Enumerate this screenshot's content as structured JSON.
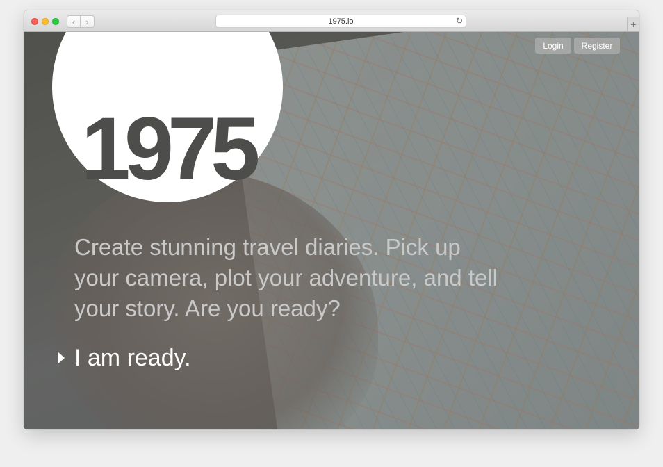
{
  "browser": {
    "url": "1975.io",
    "back_icon": "‹",
    "forward_icon": "›",
    "reload_icon": "↻",
    "new_tab_icon": "+"
  },
  "header": {
    "logo": "1975",
    "login_label": "Login",
    "register_label": "Register"
  },
  "hero": {
    "tagline": "Create stunning travel diaries. Pick up your camera, plot your adventure, and tell your story. Are you ready?",
    "cta_label": "I am ready."
  },
  "colors": {
    "logo_bg": "#ffffff",
    "logo_text": "#4d4d4b",
    "tagline": "#c9c9c9",
    "cta": "#ffffff"
  }
}
